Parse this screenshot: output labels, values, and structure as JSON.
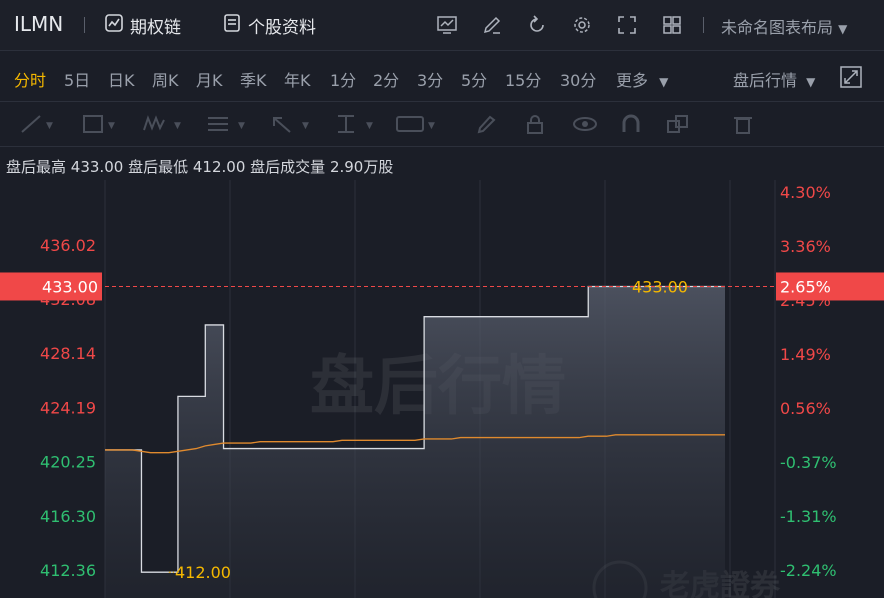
{
  "header": {
    "ticker": "ILMN",
    "options_chain": "期权链",
    "stock_info": "个股资料",
    "layout_name": "未命名图表布局"
  },
  "periods": [
    "分时",
    "5日",
    "日K",
    "周K",
    "月K",
    "季K",
    "年K",
    "1分",
    "2分",
    "3分",
    "5分",
    "15分",
    "30分",
    "更多"
  ],
  "active_period": "分时",
  "after_hours_menu": "盘后行情",
  "info": {
    "high_label": "盘后最高",
    "high_value": "433.00",
    "low_label": "盘后最低",
    "low_value": "412.00",
    "vol_label": "盘后成交量",
    "vol_value": "2.90万股"
  },
  "watermark": "盘后行情",
  "brand_watermark": "老虎證券",
  "chart_data": {
    "type": "line",
    "y_ticks_left": [
      "436.02",
      "432.08",
      "428.14",
      "424.19",
      "420.25",
      "416.30",
      "412.36"
    ],
    "y_ticks_right": [
      "4.30%",
      "3.36%",
      "2.45%",
      "1.49%",
      "0.56%",
      "-0.37%",
      "-1.31%",
      "-2.24%"
    ],
    "ylim": [
      412.36,
      436.02
    ],
    "current_price": "433.00",
    "current_pct": "2.65%",
    "max_label": "433.00",
    "min_label": "412.00",
    "price_series": [
      421.1,
      421.1,
      421.1,
      421.1,
      412.2,
      412.2,
      412.2,
      412.2,
      425.0,
      425.0,
      425.0,
      430.2,
      430.2,
      421.2,
      421.2,
      421.2,
      421.2,
      421.2,
      421.2,
      421.2,
      421.2,
      421.2,
      421.2,
      421.2,
      421.2,
      421.2,
      421.2,
      421.2,
      421.2,
      421.2,
      421.2,
      421.2,
      421.2,
      421.2,
      421.2,
      430.8,
      430.8,
      430.8,
      430.8,
      430.8,
      430.8,
      430.8,
      430.8,
      430.8,
      430.8,
      430.8,
      430.8,
      430.8,
      430.8,
      430.8,
      430.8,
      430.8,
      430.8,
      433.0,
      433.0,
      433.0,
      433.0,
      433.0,
      433.0,
      433.0,
      433.0,
      433.0,
      433.0,
      433.0,
      433.0,
      433.0,
      433.0,
      433.0,
      433.0
    ],
    "avg_series": [
      421.1,
      421.1,
      421.1,
      421.1,
      421.0,
      420.9,
      420.9,
      420.9,
      421.0,
      421.1,
      421.2,
      421.4,
      421.5,
      421.6,
      421.6,
      421.6,
      421.6,
      421.7,
      421.7,
      421.7,
      421.7,
      421.7,
      421.7,
      421.7,
      421.7,
      421.7,
      421.8,
      421.8,
      421.8,
      421.8,
      421.8,
      421.8,
      421.8,
      421.8,
      421.8,
      421.9,
      421.9,
      421.9,
      421.9,
      422.0,
      422.0,
      422.0,
      422.0,
      422.0,
      422.0,
      422.0,
      422.0,
      422.0,
      422.0,
      422.0,
      422.0,
      422.0,
      422.0,
      422.1,
      422.1,
      422.1,
      422.2,
      422.2,
      422.2,
      422.2,
      422.2,
      422.2,
      422.2,
      422.2,
      422.2,
      422.2,
      422.2,
      422.2,
      422.2
    ],
    "colors": {
      "up": "#f04848",
      "down": "#2fbf71",
      "accent": "#f5b800",
      "price_line": "#d9dce2",
      "avg_line": "#e08a2e",
      "current_tag": "#f04848"
    }
  }
}
